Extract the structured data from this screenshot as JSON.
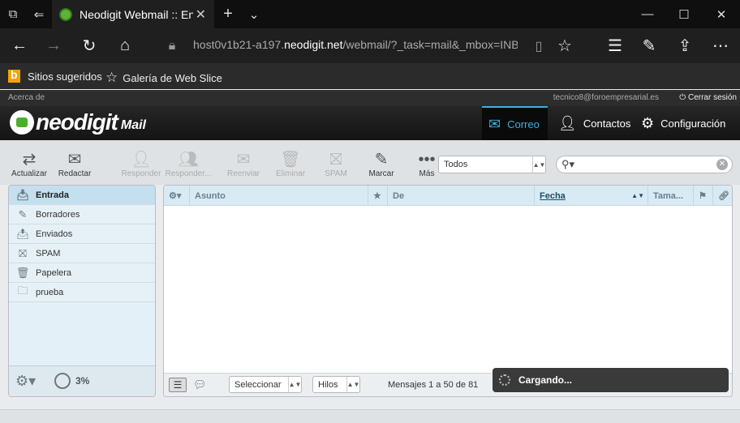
{
  "browser": {
    "tab_title": "Neodigit Webmail :: Ent",
    "url_prefix": "host0v1b21-a197.",
    "url_domain": "neodigit.net",
    "url_suffix": "/webmail/?_task=mail&_mbox=INBOX&",
    "favorites": [
      "Sitios sugeridos",
      "Galería de Web Slice"
    ]
  },
  "app": {
    "about": "Acerca de",
    "user_email": "tecnico8@foroempresarial.es",
    "logout": "Cerrar sesión",
    "logo_name": "neodigit",
    "logo_sub": "Mail",
    "nav": {
      "mail": "Correo",
      "contacts": "Contactos",
      "settings": "Configuración"
    },
    "toolbar": {
      "refresh": "Actualizar",
      "compose": "Redactar",
      "reply": "Responder",
      "reply_all": "Responder...",
      "forward": "Reenviar",
      "delete": "Eliminar",
      "spam": "SPAM",
      "mark": "Marcar",
      "more": "Más"
    },
    "filter_value": "Todos",
    "folders": [
      "Entrada",
      "Borradores",
      "Enviados",
      "SPAM",
      "Papelera",
      "prueba"
    ],
    "quota": "3%",
    "columns": {
      "subject": "Asunto",
      "from": "De",
      "date": "Fecha",
      "size": "Tama..."
    },
    "footer": {
      "select_label": "Seleccionar",
      "threads_label": "Hilos",
      "count_text": "Mensajes 1 a 50 de 81"
    },
    "loading": "Cargando..."
  }
}
